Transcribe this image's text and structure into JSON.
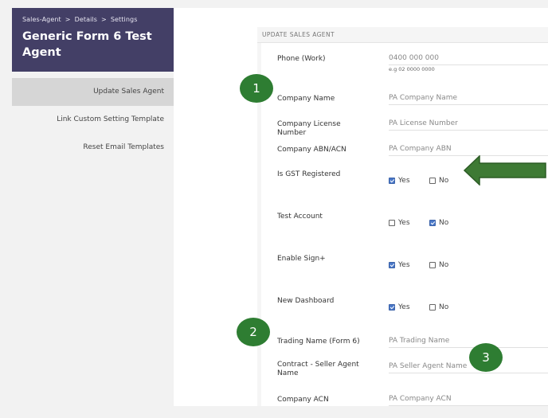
{
  "sidebar": {
    "breadcrumb": [
      "Sales-Agent",
      "Details",
      "Settings"
    ],
    "title": "Generic Form 6 Test Agent",
    "items": [
      {
        "label": "Update Sales Agent",
        "active": true
      },
      {
        "label": "Link Custom Setting Template",
        "active": false
      },
      {
        "label": "Reset Email Templates",
        "active": false
      }
    ]
  },
  "panel": {
    "heading": "UPDATE SALES AGENT"
  },
  "form": {
    "phone_work": {
      "label": "Phone (Work)",
      "placeholder": "0400 000 000",
      "hint": "e.g 02 0000 0000"
    },
    "company_name": {
      "label": "Company Name",
      "placeholder": "PA Company Name"
    },
    "company_license": {
      "label": "Company License Number",
      "placeholder": "PA License Number"
    },
    "company_abn": {
      "label": "Company ABN/ACN",
      "placeholder": "PA Company ABN"
    },
    "gst": {
      "label": "Is GST Registered",
      "yes": "Yes",
      "no": "No",
      "yes_checked": true,
      "no_checked": false
    },
    "test_account": {
      "label": "Test Account",
      "yes": "Yes",
      "no": "No",
      "yes_checked": false,
      "no_checked": true
    },
    "sign_plus": {
      "label": "Enable Sign+",
      "yes": "Yes",
      "no": "No",
      "yes_checked": true,
      "no_checked": false
    },
    "new_dashboard": {
      "label": "New Dashboard",
      "yes": "Yes",
      "no": "No",
      "yes_checked": true,
      "no_checked": false
    },
    "trading_name": {
      "label": "Trading Name (Form 6)",
      "placeholder": "PA Trading Name"
    },
    "contract_seller": {
      "label": "Contract - Seller Agent Name",
      "placeholder": "PA Seller Agent Name"
    },
    "company_acn": {
      "label": "Company ACN",
      "placeholder": "PA Company ACN"
    }
  },
  "annotations": {
    "badge_1": "1",
    "badge_2": "2",
    "badge_3": "3",
    "badge_color": "#2e7d32",
    "arrow_color": "#2e7d32"
  },
  "colors": {
    "sidebar_header": "#433f66",
    "checkbox_checked": "#4a78c8"
  }
}
